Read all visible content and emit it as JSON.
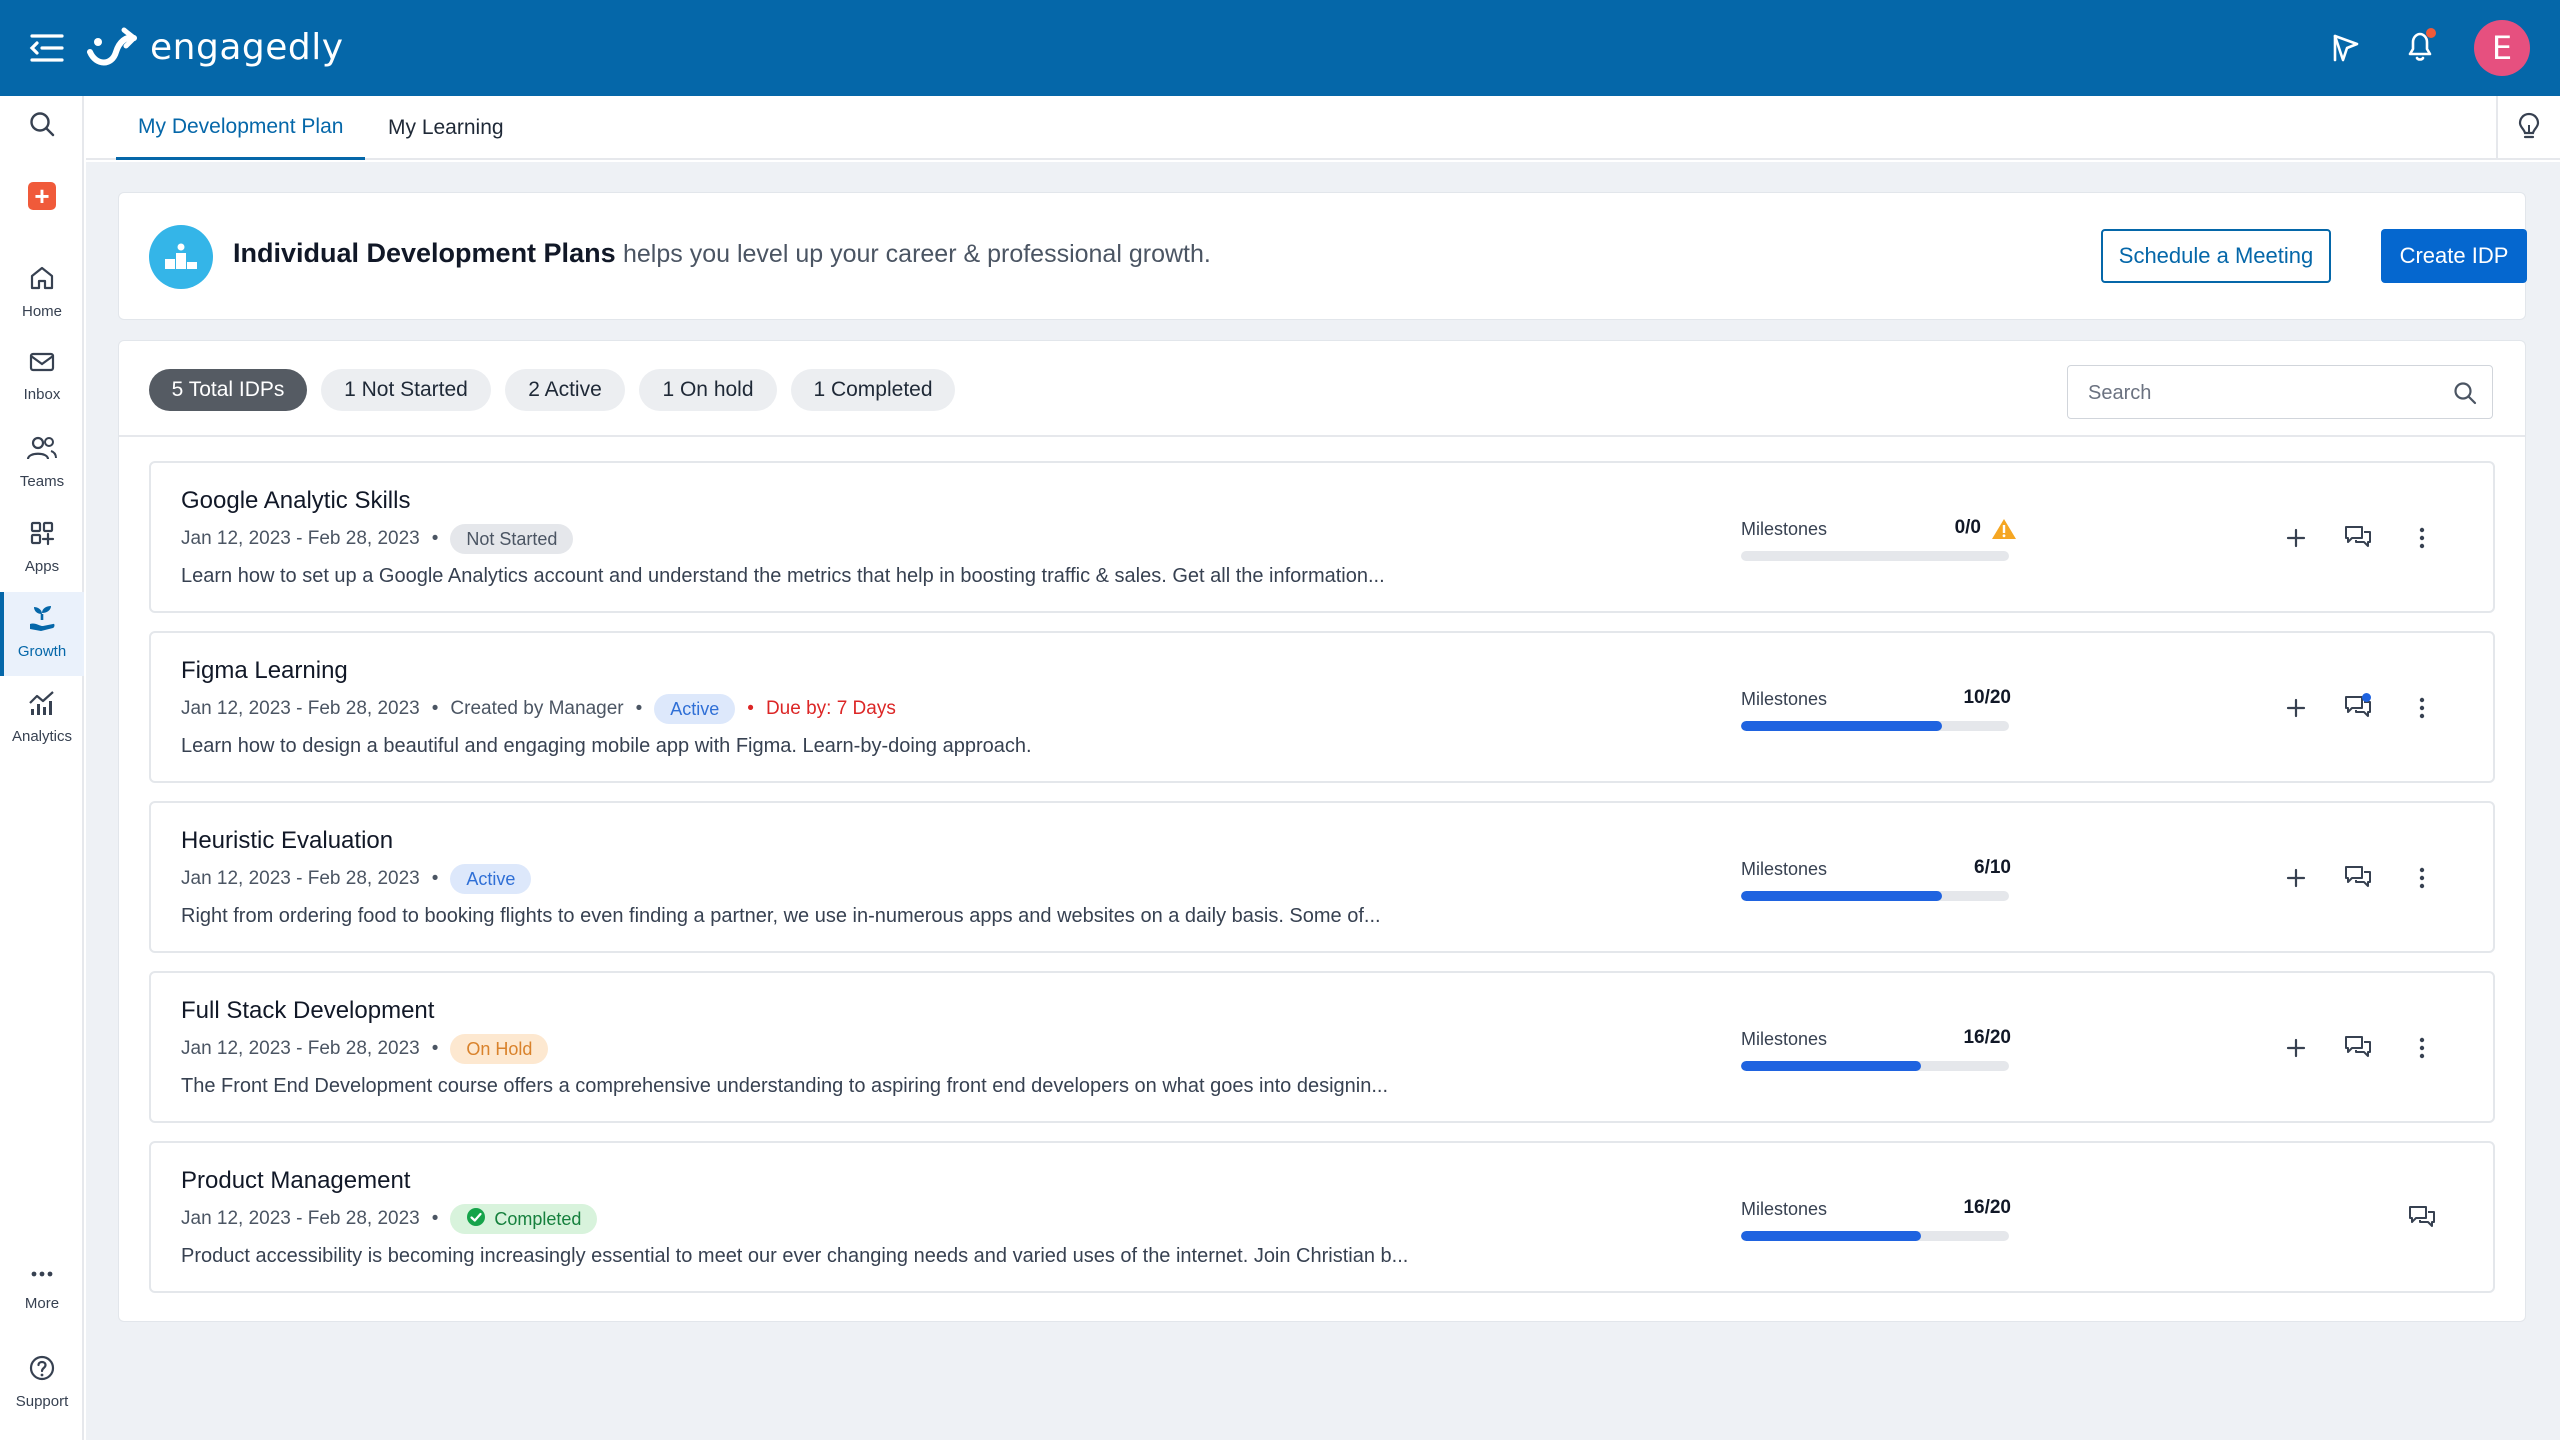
{
  "app": {
    "brand": "engagedly",
    "avatar_initial": "E"
  },
  "sidebar": {
    "items": [
      {
        "label": ""
      },
      {
        "label": ""
      },
      {
        "label": "Home"
      },
      {
        "label": "Inbox"
      },
      {
        "label": "Teams"
      },
      {
        "label": "Apps"
      },
      {
        "label": "Growth"
      },
      {
        "label": "Analytics"
      },
      {
        "label": "More"
      },
      {
        "label": "Support"
      }
    ],
    "active": "Growth"
  },
  "tabs": [
    {
      "label": "My Development Plan",
      "active": true
    },
    {
      "label": "My Learning",
      "active": false
    }
  ],
  "banner": {
    "title": "Individual Development Plans",
    "subtitle": "helps you level up your career & professional growth.",
    "schedule_button": "Schedule a Meeting",
    "create_button": "Create IDP"
  },
  "filters": [
    {
      "label": "5 Total IDPs",
      "active": true
    },
    {
      "label": "1 Not Started",
      "active": false
    },
    {
      "label": "2 Active",
      "active": false
    },
    {
      "label": "1 On hold",
      "active": false
    },
    {
      "label": "1 Completed",
      "active": false
    }
  ],
  "search": {
    "placeholder": "Search",
    "value": ""
  },
  "idps": [
    {
      "title": "Google Analytic Skills",
      "dates": "Jan 12, 2023 - Feb 28, 2023",
      "created_by": "",
      "status": "Not Started",
      "due": "",
      "description": "Learn how to set up a Google Analytics account and understand the metrics that help in boosting traffic & sales. Get all the information...",
      "milestones_label": "Milestones",
      "milestones": "0/0",
      "progress": 0,
      "warning": true
    },
    {
      "title": "Figma Learning",
      "dates": "Jan 12, 2023 - Feb 28, 2023",
      "created_by": "Created by Manager",
      "status": "Active",
      "due": "Due by: 7 Days",
      "description": "Learn how to design a beautiful and engaging mobile app with Figma. Learn-by-doing approach.",
      "milestones_label": "Milestones",
      "milestones": "10/20",
      "progress": 0.75,
      "warning": false,
      "new_comment": true
    },
    {
      "title": "Heuristic Evaluation",
      "dates": "Jan 12, 2023 - Feb 28, 2023",
      "created_by": "",
      "status": "Active",
      "due": "",
      "description": "Right from ordering food to booking flights to even finding a partner, we use in-numerous apps and websites on a daily basis. Some of...",
      "milestones_label": "Milestones",
      "milestones": "6/10",
      "progress": 0.75,
      "warning": false
    },
    {
      "title": "Full Stack Development",
      "dates": "Jan 12, 2023 - Feb 28, 2023",
      "created_by": "",
      "status": "On Hold",
      "due": "",
      "description": "The Front End Development course offers a comprehensive understanding to aspiring front end developers on what goes into designin...",
      "milestones_label": "Milestones",
      "milestones": "16/20",
      "progress": 0.67,
      "warning": false
    },
    {
      "title": "Product Management",
      "dates": "Jan 12, 2023 - Feb 28, 2023",
      "created_by": "",
      "status": "Completed",
      "due": "",
      "description": "Product accessibility is becoming increasingly essential to meet our ever changing needs and varied uses of the internet. Join Christian b...",
      "milestones_label": "Milestones",
      "milestones": "16/20",
      "progress": 0.67,
      "warning": false,
      "comment_only": true
    }
  ],
  "icons": {
    "menu": "menu-icon",
    "logo": "engagedly-logo-icon",
    "feedback": "flag-feedback-icon",
    "notifications": "bell-icon",
    "search": "search-icon",
    "bulb": "lightbulb-icon",
    "add": "plus-icon",
    "comment": "chat-icon",
    "more": "kebab-icon",
    "warning": "warning-icon",
    "check": "check-circle-icon"
  },
  "colors": {
    "header": "#0567a9",
    "primary": "#0567cf",
    "accent_orange": "#f05a3a",
    "avatar": "#e6507f"
  }
}
